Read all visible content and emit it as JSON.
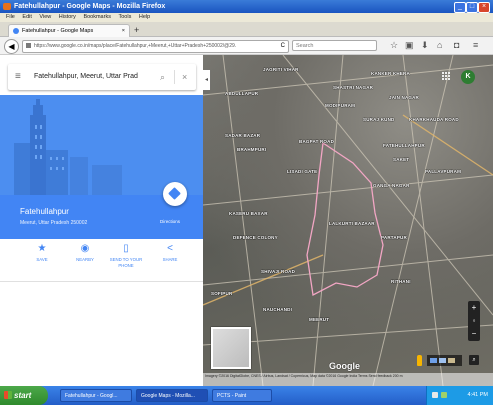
{
  "window": {
    "title": "Fatehullahpur - Google Maps - Mozilla Firefox",
    "min": "_",
    "max": "□",
    "close": "×"
  },
  "menu": [
    "File",
    "Edit",
    "View",
    "History",
    "Bookmarks",
    "Tools",
    "Help"
  ],
  "tab": {
    "label": "Fatehullahpur - Google Maps",
    "close": "×",
    "new": "+"
  },
  "nav": {
    "back": "◀",
    "url": "https://www.google.co.in/maps/place/Fatehullahpur,+Meerut,+Uttar+Pradesh+250002/@29.",
    "reload": "C",
    "search_placeholder": "Search",
    "icons": [
      "star-icon",
      "clipboard-icon",
      "download-icon",
      "home-icon",
      "pocket-icon",
      "menu-icon"
    ]
  },
  "sidebar": {
    "search": {
      "value": "Fatehullahpur, Meerut, Uttar Prad"
    },
    "place": {
      "name": "Fatehullahpur",
      "address": "Meerut, Uttar Pradesh 250002"
    },
    "directions_label": "Directions",
    "actions": [
      {
        "icon": "★",
        "label": "SAVE"
      },
      {
        "icon": "◉",
        "label": "NEARBY"
      },
      {
        "icon": "▯",
        "label": "SEND TO YOUR PHONE"
      },
      {
        "icon": "<",
        "label": "SHARE"
      }
    ]
  },
  "map": {
    "avatar": "K",
    "labels": [
      "JAGRITI VIHAR",
      "KANKER KHERA",
      "ABDULLAPUR",
      "SHASTRI NAGAR",
      "JAIN NAGAR",
      "MODIPURAM",
      "SURAJ KUND",
      "SADAR BAZAR",
      "BAGPAT ROAD",
      "FATEHULLAHPUR",
      "BRAHMPURI",
      "SAKET",
      "LISADI GATE",
      "PALLAVPURAM",
      "GANGA NAGAR",
      "KASERU BAXAR",
      "LALKURTI BAZAAR",
      "DEFENCE COLONY",
      "PARTAPUR",
      "SHIVAJI ROAD",
      "RITHANI",
      "SOFIPUR",
      "MEERUT",
      "NAUCHANDI",
      "KHARKHAUDA ROAD"
    ],
    "zoom_in": "+",
    "zoom_out": "−",
    "google": "Google",
    "attribution": "Imagery ©2016 DigitalGlobe, CNES / Airbus, Landsat / Copernicus, Map data ©2016 Google   India   Terms   Send feedback   200 m"
  },
  "taskbar": {
    "start": "start",
    "items": [
      "Fatehullahpur - Googl...",
      "Google Maps - Mozilla...",
      "PCTS - Paint"
    ],
    "clock": "4:41 PM"
  }
}
